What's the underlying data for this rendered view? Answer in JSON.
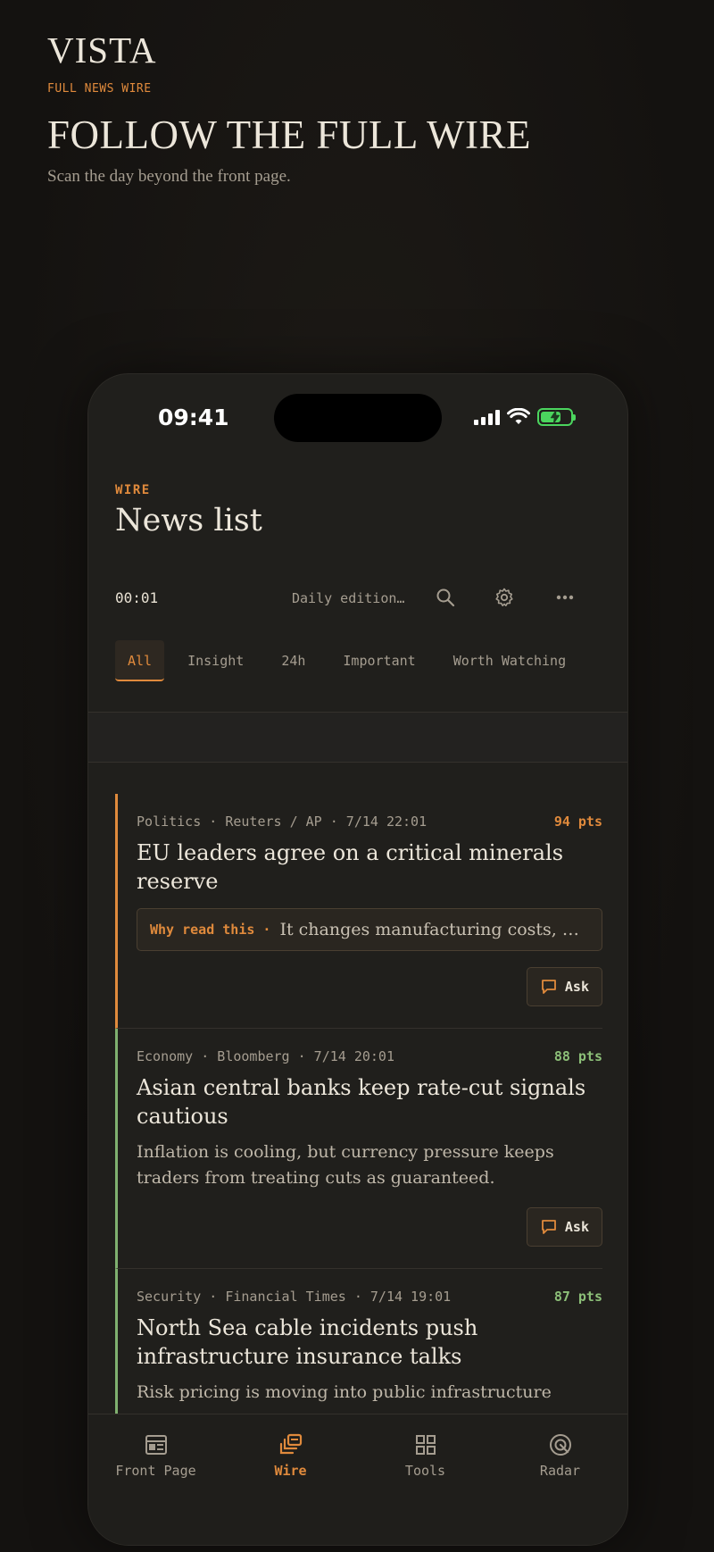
{
  "hero": {
    "brand": "VISTA",
    "kicker": "FULL NEWS WIRE",
    "headline": "FOLLOW THE FULL WIRE",
    "subtitle": "Scan the day beyond the front page."
  },
  "status_bar": {
    "time": "09:41"
  },
  "page": {
    "kicker": "WIRE",
    "title": "News list"
  },
  "toolbar": {
    "clock": "00:01",
    "edition": "Daily edition…",
    "icons": [
      "search-icon",
      "gear-icon",
      "more-icon"
    ]
  },
  "tabs": [
    {
      "label": "All",
      "active": true
    },
    {
      "label": "Insight"
    },
    {
      "label": "24h"
    },
    {
      "label": "Important"
    },
    {
      "label": "Worth Watching"
    }
  ],
  "feed": [
    {
      "category": "Politics",
      "source": "Reuters / AP",
      "time": "7/14 22:01",
      "meta": "Politics · Reuters / AP · 7/14 22:01",
      "points": "94 pts",
      "title": "EU leaders agree on a critical minerals reserve",
      "why_label": "Why read this ·",
      "why_text": "It changes manufacturing costs, defense supply chains",
      "ask": "Ask",
      "accent": "#e08a3c"
    },
    {
      "category": "Economy",
      "source": "Bloomberg",
      "time": "7/14 20:01",
      "meta": "Economy · Bloomberg · 7/14 20:01",
      "points": "88 pts",
      "title": "Asian central banks keep rate-cut signals cautious",
      "summary": "Inflation is cooling, but currency pressure keeps traders from treating cuts as guaranteed.",
      "ask": "Ask",
      "accent": "#7fb06f"
    },
    {
      "category": "Security",
      "source": "Financial Times",
      "time": "7/14 19:01",
      "meta": "Security · Financial Times · 7/14 19:01",
      "points": "87 pts",
      "title": "North Sea cable incidents push infrastructure insurance talks",
      "summary": "Risk pricing is moving into public infrastructure",
      "accent": "#7fb06f"
    }
  ],
  "nav": [
    {
      "label": "Front Page",
      "icon": "newspaper-icon"
    },
    {
      "label": "Wire",
      "icon": "stack-icon",
      "active": true
    },
    {
      "label": "Tools",
      "icon": "grid-icon"
    },
    {
      "label": "Radar",
      "icon": "radar-icon"
    }
  ],
  "colors": {
    "accent": "#e08a3c",
    "green": "#7fb06f",
    "bg": "#151311",
    "phone": "#201f1c"
  }
}
